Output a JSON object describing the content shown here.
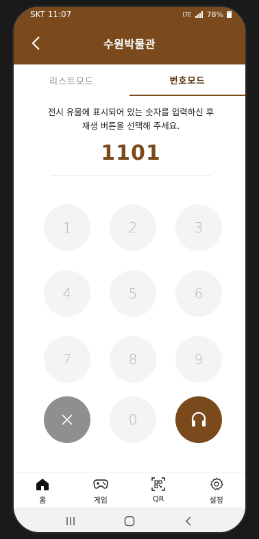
{
  "status": {
    "carrier": "SKT",
    "time": "11:07",
    "network": "LTE",
    "battery": "78%"
  },
  "header": {
    "title": "수원박물관"
  },
  "tabs": [
    {
      "label": "리스트모드",
      "active": false
    },
    {
      "label": "번호모드",
      "active": true
    }
  ],
  "instruction": {
    "line1": "전시 유물에 표시되어 있는 숫자를 입력하신 후",
    "line2": "재생 버튼을 선택해 주세요."
  },
  "number_input": {
    "value": "1101"
  },
  "keypad": {
    "keys": [
      "1",
      "2",
      "3",
      "4",
      "5",
      "6",
      "7",
      "8",
      "9"
    ],
    "zero": "0",
    "clear_icon": "close-icon",
    "play_icon": "headphones-icon"
  },
  "bottom_nav": [
    {
      "label": "홈",
      "icon": "home-icon"
    },
    {
      "label": "게임",
      "icon": "gamepad-icon"
    },
    {
      "label": "QR",
      "icon": "qr-code-icon"
    },
    {
      "label": "설정",
      "icon": "gear-icon"
    }
  ],
  "colors": {
    "brand": "#7a4a1d",
    "tab_active": "#5b3210",
    "key_bg": "#f4f4f4",
    "clear_bg": "#8f8f8f"
  }
}
